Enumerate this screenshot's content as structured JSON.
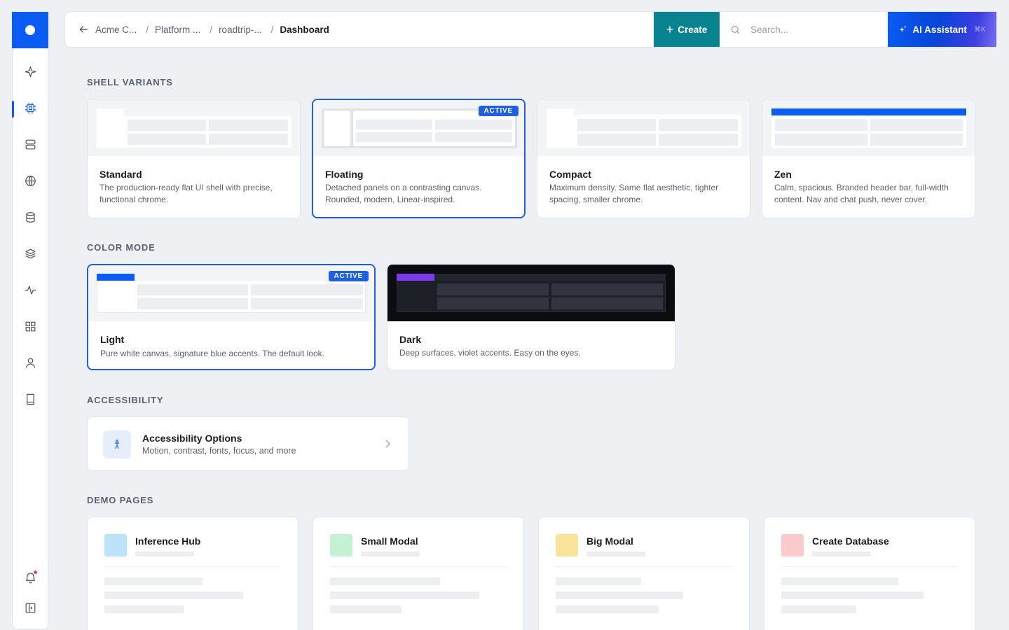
{
  "breadcrumbs": [
    "Acme C...",
    "Platform ...",
    "roadtrip-...",
    "Dashboard"
  ],
  "header": {
    "create_label": "Create",
    "search_placeholder": "Search...",
    "ai_label": "AI Assistant",
    "ai_shortcut": "⌘K"
  },
  "sections": {
    "shell": "SHELL VARIANTS",
    "color": "COLOR MODE",
    "a11y": "ACCESSIBILITY",
    "demo": "DEMO PAGES"
  },
  "badge_label": "ACTIVE",
  "shell_variants": [
    {
      "name": "Standard",
      "desc": "The production-ready flat UI shell with precise, functional chrome.",
      "active": false
    },
    {
      "name": "Floating",
      "desc": "Detached panels on a contrasting canvas. Rounded, modern, Linear-inspired.",
      "active": true
    },
    {
      "name": "Compact",
      "desc": "Maximum density. Same flat aesthetic, tighter spacing, smaller chrome.",
      "active": false
    },
    {
      "name": "Zen",
      "desc": "Calm, spacious. Branded header bar, full-width content. Nav and chat push, never cover.",
      "active": false
    }
  ],
  "color_modes": [
    {
      "name": "Light",
      "desc": "Pure white canvas, signature blue accents. The default look.",
      "active": true
    },
    {
      "name": "Dark",
      "desc": "Deep surfaces, violet accents. Easy on the eyes.",
      "active": false
    }
  ],
  "accessibility": {
    "title": "Accessibility Options",
    "subtitle": "Motion, contrast, fonts, focus, and more"
  },
  "demo_pages": [
    {
      "name": "Inference Hub",
      "color": "#bde3fa"
    },
    {
      "name": "Small Modal",
      "color": "#c4f2d2"
    },
    {
      "name": "Big Modal",
      "color": "#f9e49a"
    },
    {
      "name": "Create Database",
      "color": "#fbcaca"
    }
  ],
  "colors": {
    "brand": "#0a5cf5",
    "create": "#0a8391",
    "active_border": "#1f5fe0",
    "violet": "#7c3aed"
  },
  "nav_icons": [
    "sparkle-icon",
    "chip-icon",
    "server-icon",
    "globe-icon",
    "database-icon",
    "layers-icon",
    "activity-icon",
    "grid-icon",
    "user-icon",
    "book-icon",
    "bell-icon",
    "panel-toggle-icon"
  ]
}
